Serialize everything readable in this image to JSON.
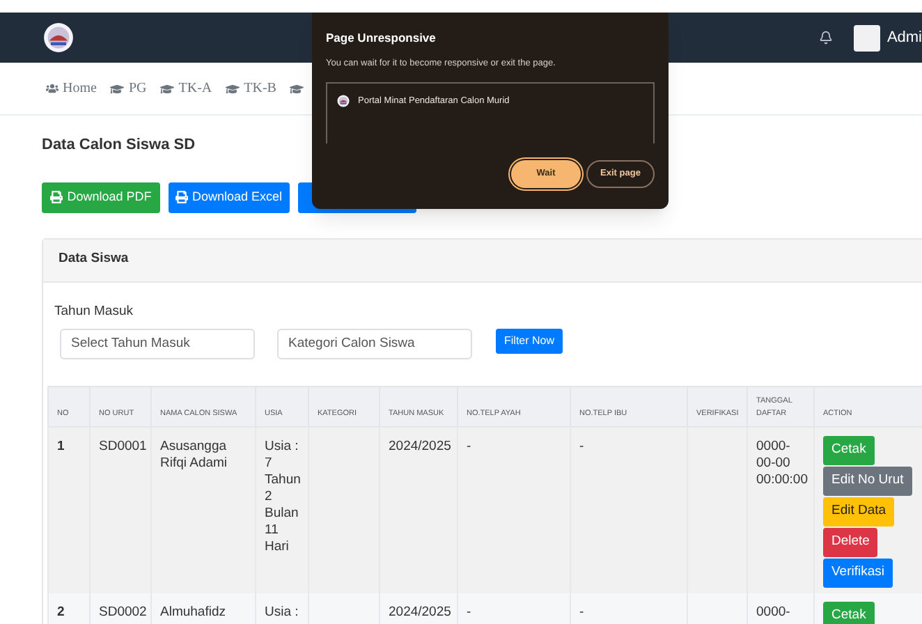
{
  "navbar": {
    "user": "Admi"
  },
  "breadcrumbs": [
    {
      "label": "Home",
      "kind": "home"
    },
    {
      "label": "PG",
      "kind": "grad"
    },
    {
      "label": "TK-A",
      "kind": "grad"
    },
    {
      "label": "TK-B",
      "kind": "grad"
    },
    {
      "kind": "grad"
    }
  ],
  "page_title": "Data Calon Siswa SD",
  "toolbar": [
    {
      "label": "Download PDF",
      "color": "#28a745"
    },
    {
      "label": "Download Excel",
      "color": "#007bff"
    },
    {
      "color": "#007bff"
    }
  ],
  "card": {
    "title": "Data Siswa",
    "filter_label": "Tahun Masuk",
    "filters": [
      {
        "placeholder": "Select Tahun Masuk"
      },
      {
        "placeholder": "Kategori Calon Siswa"
      }
    ],
    "filter_button": "Filter Now",
    "table": {
      "columns": [
        "NO",
        "NO URUT",
        "NAMA CALON SISWA",
        "USIA",
        "KATEGORI",
        "TAHUN MASUK",
        "NO.TELP AYAH",
        "NO.TELP IBU",
        "VERIFIKASI",
        "TANGGAL DAFTAR",
        "ACTION"
      ],
      "rows": [
        {
          "cells": [
            "1",
            "SD0001",
            "Asusangga Rifqi Adami",
            "Usia : 7 Tahun 2 Bulan 11 Hari",
            "",
            "2024/2025",
            "-",
            "-",
            "",
            "0000-00-00 00:00:00"
          ],
          "actions": [
            {
              "label": "Cetak",
              "color": "#28a745"
            },
            {
              "label": "Edit No Urut",
              "color": "#6c757d"
            },
            {
              "label": "Edit Data",
              "color": "#ffc107"
            },
            {
              "label": "Delete",
              "color": "#dc3545"
            },
            {
              "label": "Verifikasi",
              "color": "#007bff"
            }
          ]
        },
        {
          "cells": [
            "2",
            "SD0002",
            "Almuhafidz",
            "Usia :",
            "",
            "2024/2025",
            "-",
            "-",
            "",
            "0000-"
          ],
          "actions": [
            {
              "label": "Cetak",
              "color": "#28a745"
            }
          ]
        }
      ]
    }
  },
  "dialog": {
    "title": "Page Unresponsive",
    "message": "You can wait for it to become responsive or exit the page.",
    "page": "Portal Minat Pendaftaran Calon Murid",
    "buttons": [
      {
        "label": "Wait",
        "kind": "primary"
      },
      {
        "label": "Exit page",
        "kind": "secondary"
      }
    ]
  }
}
